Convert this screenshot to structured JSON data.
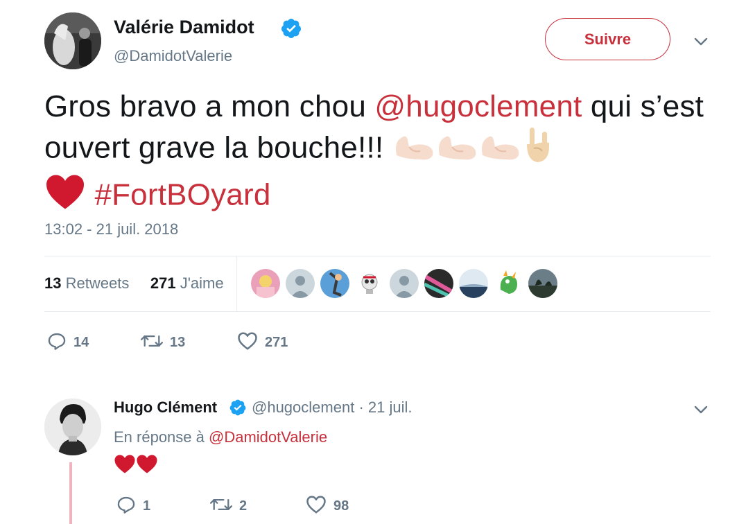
{
  "tweet": {
    "author_name": "Valérie Damidot",
    "author_handle": "@DamidotValerie",
    "follow_label": "Suivre",
    "text_part1": "Gros bravo a mon chou ",
    "mention": "@hugoclement",
    "text_part2": " qui s’est ouvert grave la bouche!!! ",
    "hashtag": "#FortBOyard",
    "emojis": [
      "flexed-biceps",
      "flexed-biceps",
      "flexed-biceps",
      "sign-of-the-horns",
      "red-heart"
    ],
    "timestamp": "13:02 - 21 juil. 2018",
    "retweet_count": "13",
    "retweets_label": "Retweets",
    "like_count": "271",
    "likes_label": "J'aime",
    "liker_avatars": 9,
    "actions": {
      "replies": "14",
      "retweets": "13",
      "likes": "271"
    }
  },
  "reply": {
    "author_name": "Hugo Clément",
    "author_handle": "@hugoclement",
    "date": "21 juil.",
    "separator": "·",
    "in_reply_prefix": "En réponse à",
    "in_reply_to": "@DamidotValerie",
    "body_emojis": [
      "red-heart",
      "red-heart"
    ],
    "actions": {
      "replies": "1",
      "retweets": "2",
      "likes": "98"
    }
  },
  "colors": {
    "accent": "#c8303c",
    "verified": "#1da1f2",
    "muted": "#657786",
    "text": "#14171a",
    "divider": "#e6ecf0",
    "thread_line": "#f2b3c0"
  },
  "icons": [
    "verified-badge-icon",
    "chevron-down-icon",
    "reply-icon",
    "retweet-icon",
    "like-icon"
  ]
}
